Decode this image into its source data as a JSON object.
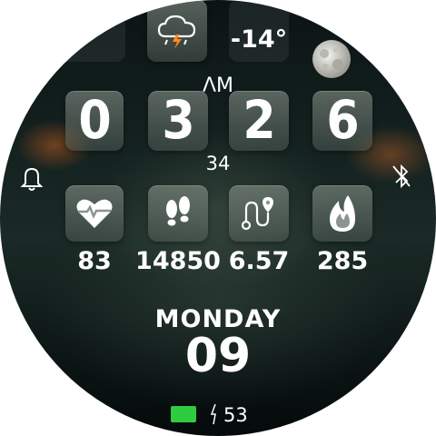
{
  "weather": {
    "icon": "thunderstorm-icon",
    "temperature": "-14°"
  },
  "moon": {
    "icon": "full-moon-icon"
  },
  "time": {
    "ampm": "ΛM",
    "digits": [
      "0",
      "3",
      "2",
      "6"
    ],
    "seconds": "34"
  },
  "status": {
    "alarm_icon": "bell-icon",
    "bluetooth_icon": "bluetooth-off-icon"
  },
  "stats": [
    {
      "name": "heart-rate",
      "icon": "heart-icon",
      "value": "83"
    },
    {
      "name": "steps",
      "icon": "footprints-icon",
      "value": "14850"
    },
    {
      "name": "distance",
      "icon": "route-icon",
      "value": "6.57"
    },
    {
      "name": "calories",
      "icon": "flame-icon",
      "value": "285"
    }
  ],
  "date": {
    "weekday": "MONDAY",
    "day": "09"
  },
  "battery": {
    "icon": "battery-icon",
    "percent": "53",
    "level": 0.53,
    "color": "#2ecc40"
  },
  "colors": {
    "accent": "#2ecc40",
    "tile": "#8a958e",
    "flash": "#ff8c1a"
  }
}
